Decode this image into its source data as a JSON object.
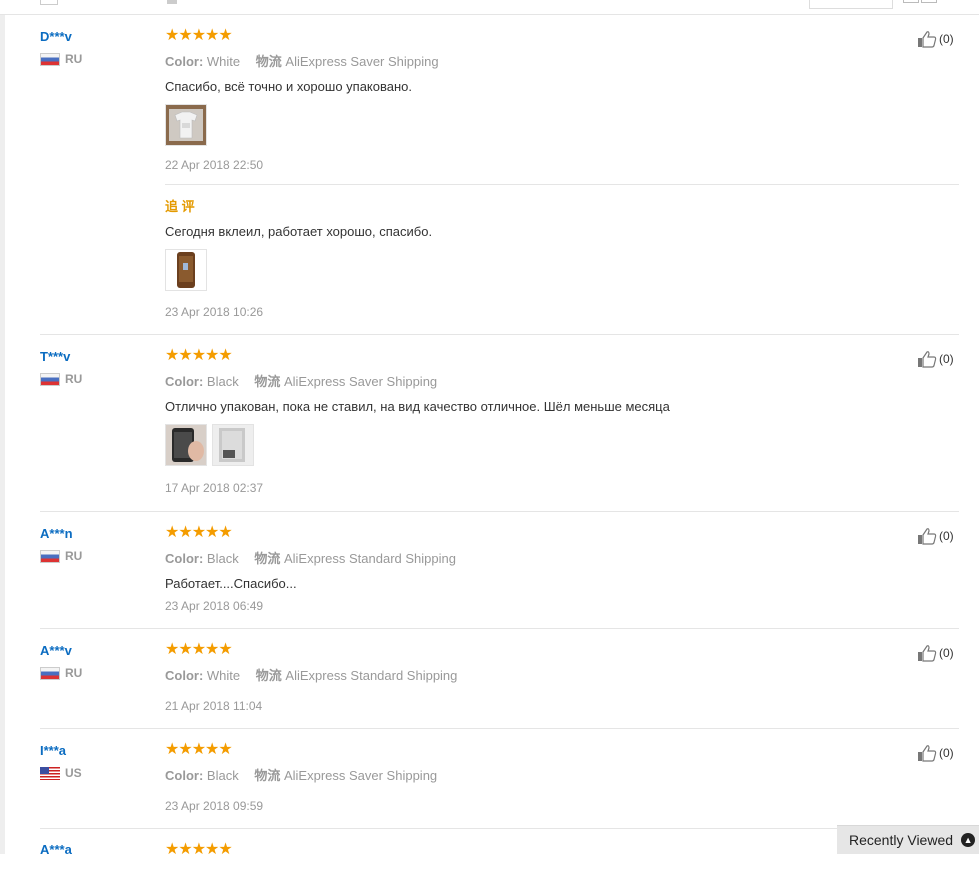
{
  "color_label": "Color:",
  "shipping_label": "物流",
  "reviews": [
    {
      "user": "D***v",
      "country": "RU",
      "stars": "★★★★★",
      "color": "White",
      "shipping": "AliExpress Saver Shipping",
      "text": "Спасибо, всё точно и хорошо упаковано.",
      "date": "22 Apr 2018 22:50",
      "helpful": "(0)",
      "additional": {
        "title": "追 评",
        "text": "Сегодня вклеил, работает хорошо, спасибо.",
        "date": "23 Apr 2018 10:26"
      }
    },
    {
      "user": "T***v",
      "country": "RU",
      "stars": "★★★★★",
      "color": "Black",
      "shipping": "AliExpress Saver Shipping",
      "text": "Отлично упакован, пока не ставил, на вид качество отличное. Шёл меньше месяца",
      "date": "17 Apr 2018 02:37",
      "helpful": "(0)"
    },
    {
      "user": "A***n",
      "country": "RU",
      "stars": "★★★★★",
      "color": "Black",
      "shipping": "AliExpress Standard Shipping",
      "text": "Работает....Спасибо...",
      "date": "23 Apr 2018 06:49",
      "helpful": "(0)"
    },
    {
      "user": "A***v",
      "country": "RU",
      "stars": "★★★★★",
      "color": "White",
      "shipping": "AliExpress Standard Shipping",
      "date": "21 Apr 2018 11:04",
      "helpful": "(0)"
    },
    {
      "user": "I***a",
      "country": "US",
      "stars": "★★★★★",
      "color": "Black",
      "shipping": "AliExpress Saver Shipping",
      "date": "23 Apr 2018 09:59",
      "helpful": "(0)"
    },
    {
      "user": "A***a",
      "stars": "★★★★★"
    }
  ],
  "recently_viewed": "Recently Viewed",
  "icons": {
    "helpful": "thumbs-up-icon",
    "recent": "chevron-up-icon"
  },
  "colors": {
    "username": "#0b6cc1",
    "stars": "#f49c00",
    "followup_title": "#e49a00"
  }
}
